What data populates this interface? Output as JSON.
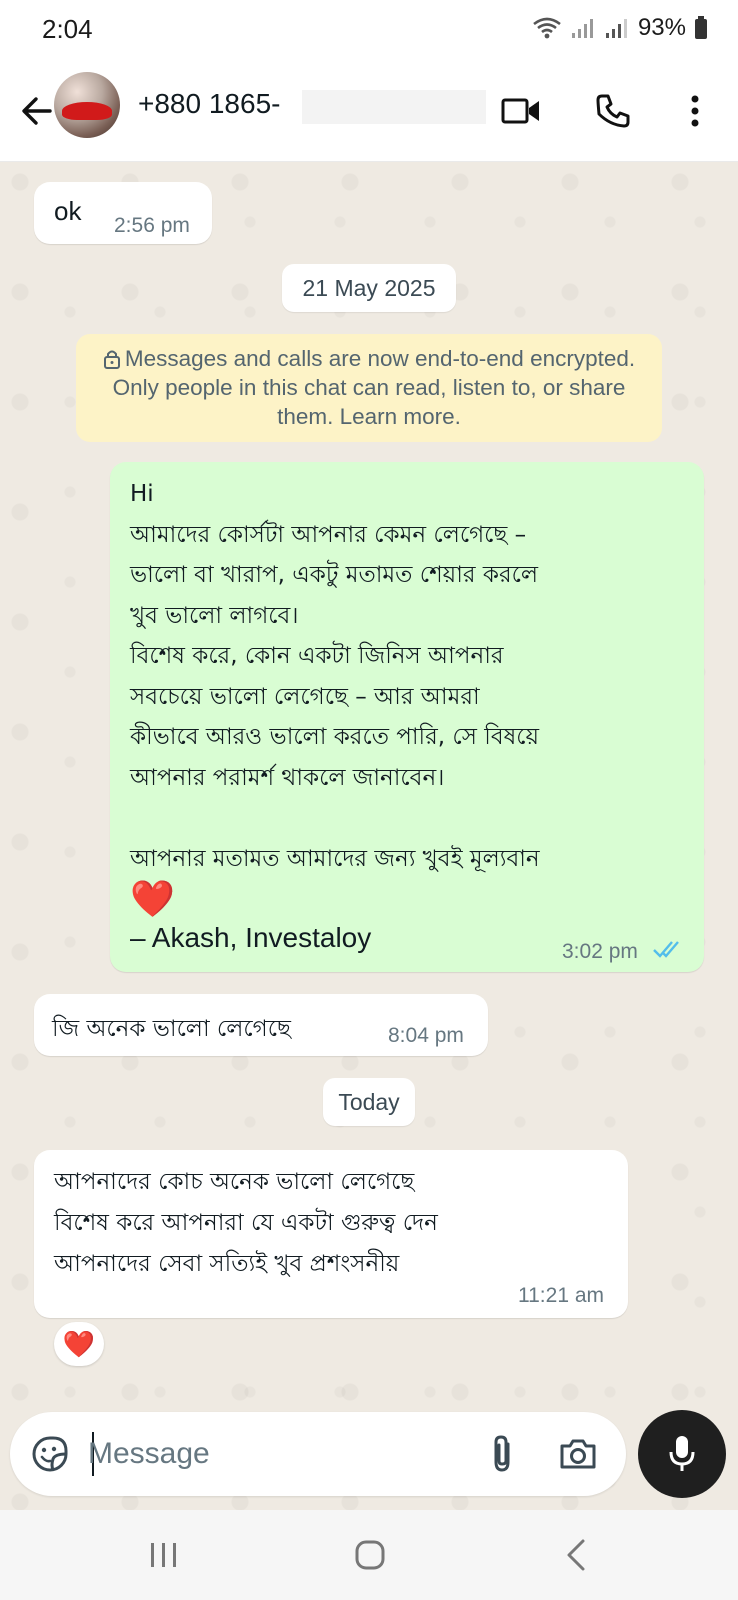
{
  "status_bar": {
    "time": "2:04",
    "battery": "93%"
  },
  "header": {
    "contact": "+880 1865-",
    "back_icon": "arrow-left-icon",
    "video_icon": "video-camera-icon",
    "call_icon": "phone-icon",
    "menu_icon": "more-vertical-icon"
  },
  "messages": [
    {
      "direction": "in",
      "text": "ok",
      "time": "2:56 pm"
    },
    {
      "direction": "out",
      "text": "Hi\nআমাদের কোর্সটা আপনার কেমন লেগেছে –\nভালো বা খারাপ, একটু মতামত শেয়ার করলে\nখুব ভালো লাগবে।\nবিশেষ করে, কোন একটা জিনিস আপনার\nসবচেয়ে ভালো লেগেছে – আর আমরা\nকীভাবে আরও ভালো করতে পারি, সে বিষয়ে\nআপনার পরামর্শ থাকলে জানাবেন।\n\nআপনার মতামত আমাদের জন্য খুবই মূল্যবান",
      "heart": "❤️",
      "signature": "– Akash, Investaloy",
      "time": "3:02 pm",
      "status": "read"
    },
    {
      "direction": "in",
      "text": "জি অনেক ভালো লেগেছে",
      "time": "8:04 pm"
    },
    {
      "direction": "in",
      "text": "আপনাদের কোচ অনেক ভালো লেগেছে\nবিশেষ করে আপনারা যে একটা গুরুত্ব দেন\nআপনাদের সেবা সত্যিই খুব প্রশংসনীয়",
      "time": "11:21 am",
      "reaction": "❤️"
    }
  ],
  "date_separators": [
    "21 May 2025",
    "Today"
  ],
  "encryption_notice": "Messages and calls are now end-to-end encrypted. Only people in this chat can read, listen to, or share them. Learn more.",
  "composer": {
    "placeholder": "Message",
    "emoji_icon": "sticker-icon",
    "attach_icon": "paperclip-icon",
    "camera_icon": "camera-icon",
    "mic_icon": "microphone-icon"
  },
  "colors": {
    "outgoing_bubble": "#d9fdd3",
    "incoming_bubble": "#ffffff",
    "chat_background": "#efeae2",
    "notice_background": "#fdf3c7",
    "read_ticks": "#53bdeb"
  }
}
